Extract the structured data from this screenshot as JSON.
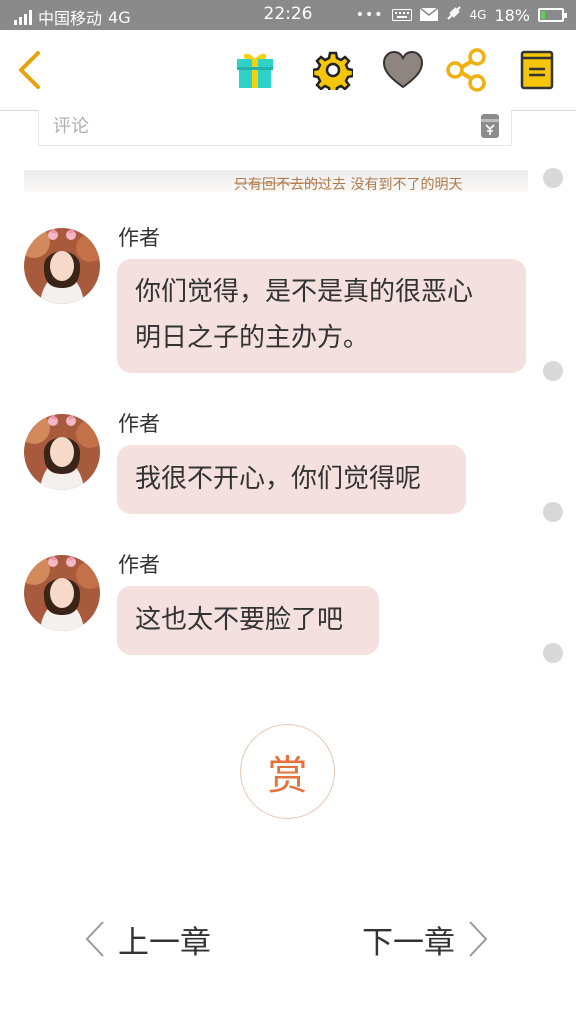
{
  "status_bar": {
    "carrier": "中国移动",
    "network": "4G",
    "time": "22:26",
    "dots": "•••",
    "network_right": "4G",
    "battery": "18%",
    "battery_fraction": 0.18,
    "battery_color": "#55d44d"
  },
  "toolbar": {
    "back_icon": "chevron-left-icon",
    "gift_icon": "gift-icon",
    "settings_icon": "gear-icon",
    "like_icon": "heart-icon",
    "share_icon": "share-icon",
    "book_icon": "notebook-icon",
    "accent": "#e8a20c"
  },
  "comment": {
    "placeholder": "评论"
  },
  "banner": {
    "text": "只有回不去的过去  没有到不了的明天"
  },
  "messages": [
    {
      "author": "作者",
      "lines": [
        "你们觉得，是不是真的很恶心",
        "明日之子的主办方。"
      ]
    },
    {
      "author": "作者",
      "lines": [
        "我很不开心，你们觉得呢"
      ]
    },
    {
      "author": "作者",
      "lines": [
        "这也太不要脸了吧"
      ]
    }
  ],
  "reward": {
    "label": "赏",
    "color": "#e4713e"
  },
  "chapter_nav": {
    "prev_label": "上一章",
    "next_label": "下一章"
  },
  "bubble_color": "#f5e0e0"
}
